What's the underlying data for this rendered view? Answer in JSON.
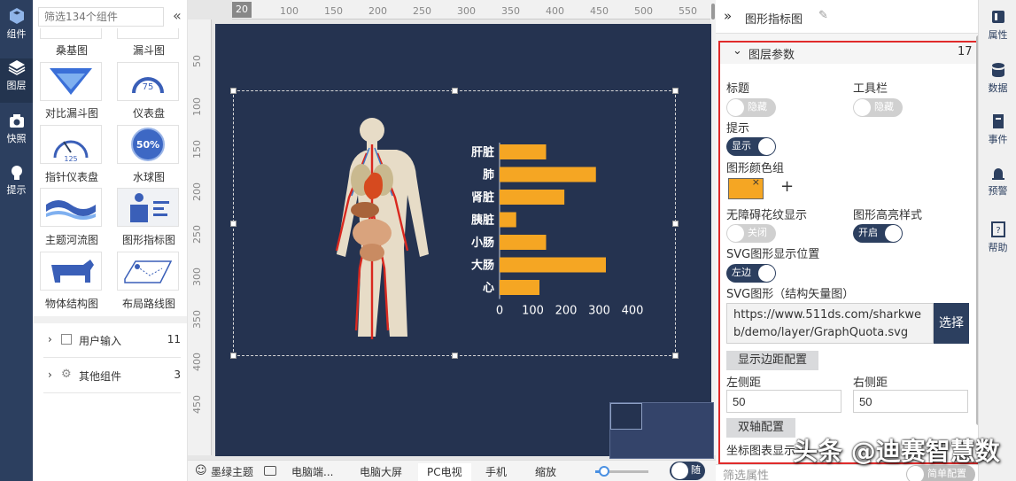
{
  "left_nav": {
    "items": [
      {
        "label": "组件",
        "icon": "cube-icon"
      },
      {
        "label": "图层",
        "icon": "layers-icon"
      },
      {
        "label": "快照",
        "icon": "camera-icon"
      },
      {
        "label": "提示",
        "icon": "bulb-icon"
      }
    ]
  },
  "components": {
    "search_placeholder": "筛选134个组件",
    "collapse_glyph": "«",
    "tiles": [
      {
        "label": "桑基图"
      },
      {
        "label": "漏斗图"
      },
      {
        "label": "对比漏斗图"
      },
      {
        "label": "仪表盘"
      },
      {
        "label": "指针仪表盘"
      },
      {
        "label": "水球图"
      },
      {
        "label": "主题河流图"
      },
      {
        "label": "图形指标图"
      },
      {
        "label": "物体结构图"
      },
      {
        "label": "布局路线图"
      }
    ],
    "gauge_value": "75",
    "gauge_value2": "125",
    "liquid_value": "50%",
    "groups": [
      {
        "label": "用户输入",
        "count": "11"
      },
      {
        "label": "其他组件",
        "count": "3"
      }
    ]
  },
  "ruler": {
    "top": [
      "20",
      "100",
      "150",
      "200",
      "250",
      "300",
      "350",
      "400",
      "450",
      "500",
      "550"
    ],
    "left": [
      "50",
      "100",
      "150",
      "200",
      "250",
      "300",
      "350",
      "400",
      "450"
    ]
  },
  "chart_data": {
    "type": "bar",
    "orientation": "horizontal",
    "categories": [
      "肝脏",
      "肺",
      "肾脏",
      "胰脏",
      "小肠",
      "大肠",
      "心"
    ],
    "values": [
      140,
      290,
      195,
      50,
      140,
      320,
      120
    ],
    "xlim": [
      0,
      400
    ],
    "xticks": [
      "0",
      "100",
      "200",
      "300",
      "400"
    ],
    "bar_color": "#f5a623"
  },
  "bottom_bar": {
    "tabs": [
      "墨绿主题",
      "电脑端...",
      "电脑大屏",
      "PC电视",
      "手机",
      "缩放"
    ],
    "selected": "PC电视",
    "toggle": "随"
  },
  "right": {
    "title": "图形指标图",
    "section": {
      "title": "图层参数",
      "count": "17"
    },
    "title_label": "标题",
    "title_toggle": "隐藏",
    "toolbar_label": "工具栏",
    "toolbar_toggle": "隐藏",
    "tip_label": "提示",
    "tip_toggle": "显示",
    "color_group_label": "图形颜色组",
    "color_swatch": "#f5a623",
    "add_glyph": "+",
    "a11y_label": "无障碍花纹显示",
    "a11y_toggle": "关闭",
    "highlight_label": "图形高亮样式",
    "highlight_toggle": "开启",
    "svg_pos_label": "SVG图形显示位置",
    "svg_pos_toggle": "左边",
    "svg_label": "SVG图形（结构矢量图）",
    "svg_url": "https://www.511ds.com/sharkweb/demo/layer/GraphQuota.svg",
    "choose_button": "选择",
    "margin_button": "显示边距配置",
    "left_margin_label": "左侧距",
    "left_margin": "50",
    "right_margin_label": "右侧距",
    "right_margin": "50",
    "dual_axis_button": "双轴配置",
    "axis_label": "坐标图表显示",
    "filter_placeholder": "筛选属性",
    "simple_config": "简单配置"
  },
  "right_bar": {
    "items": [
      "属性",
      "数据",
      "事件",
      "预警",
      "帮助"
    ]
  },
  "watermark": "头条 @迪赛智慧数"
}
